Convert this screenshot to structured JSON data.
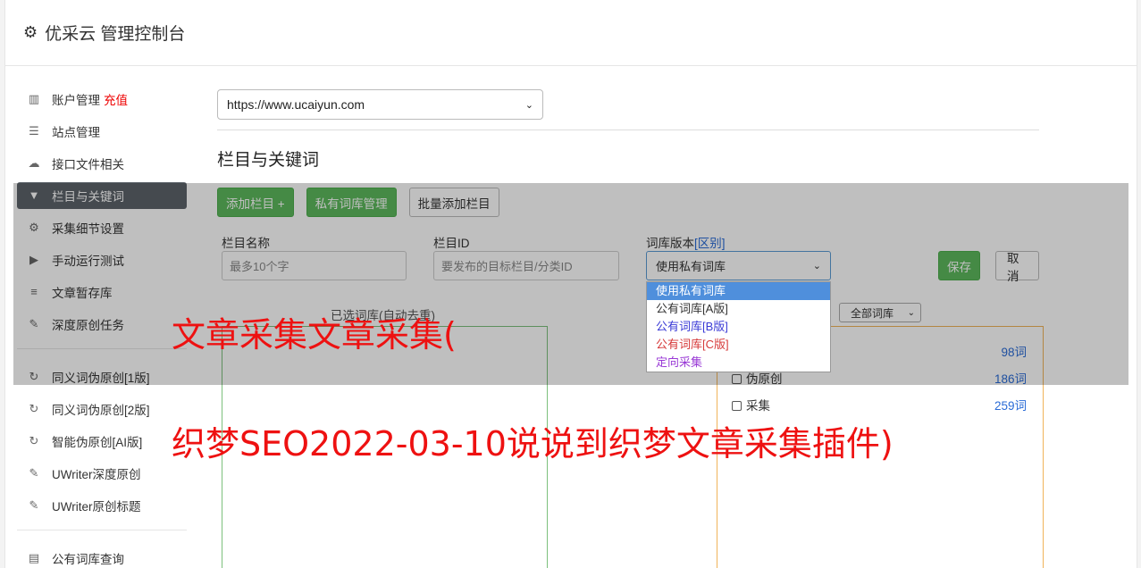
{
  "header": {
    "title": "优采云 管理控制台"
  },
  "sidebar": {
    "items": [
      {
        "label": "账户管理",
        "badge": "充值",
        "icon": "bar-chart-icon"
      },
      {
        "label": "站点管理",
        "icon": "server-icon"
      },
      {
        "label": "接口文件相关",
        "icon": "cloud-upload-icon"
      },
      {
        "label": "栏目与关键词",
        "icon": "filter-icon"
      },
      {
        "label": "采集细节设置",
        "icon": "cogs-icon"
      },
      {
        "label": "手动运行测试",
        "icon": "play-circle-icon"
      },
      {
        "label": "文章暂存库",
        "icon": "database-icon"
      },
      {
        "label": "深度原创任务",
        "icon": "edit-icon"
      }
    ],
    "items2": [
      {
        "label": "同义词伪原创[1版]",
        "icon": "refresh-icon"
      },
      {
        "label": "同义词伪原创[2版]",
        "icon": "refresh-icon"
      },
      {
        "label": "智能伪原创[AI版]",
        "icon": "refresh-icon"
      },
      {
        "label": "UWriter深度原创",
        "icon": "edit-icon"
      },
      {
        "label": "UWriter原创标题",
        "icon": "edit-icon"
      }
    ],
    "items3": [
      {
        "label": "公有词库查询",
        "icon": "book-icon"
      }
    ]
  },
  "main": {
    "site_select": "https://www.ucaiyun.com",
    "section_title": "栏目与关键词",
    "buttons": {
      "add_column": "添加栏目 +",
      "private_lib": "私有词库管理",
      "batch_add": "批量添加栏目"
    },
    "form": {
      "name_label": "栏目名称",
      "name_placeholder": "最多10个字",
      "id_label": "栏目ID",
      "id_placeholder": "要发布的目标栏目/分类ID",
      "lib_label": "词库版本",
      "lib_link": "[区别]",
      "lib_selected": "使用私有词库",
      "save": "保存",
      "cancel": "取消"
    },
    "lib_options": [
      {
        "label": "使用私有词库",
        "color": "#ffffff"
      },
      {
        "label": "公有词库[A版]",
        "color": "#333333"
      },
      {
        "label": "公有词库[B版]",
        "color": "#3a3ad6"
      },
      {
        "label": "公有词库[C版]",
        "color": "#d63a3a"
      },
      {
        "label": "定向采集",
        "color": "#9a3ad6"
      }
    ],
    "selected_label": "已选词库(自动去重)",
    "all_lib_select": "全部词库",
    "lib_list": [
      {
        "label": "",
        "count": "98词"
      },
      {
        "label": "伪原创",
        "count": "186词"
      },
      {
        "label": "采集",
        "count": "259词"
      }
    ]
  },
  "watermark": {
    "line1": "文章采集文章采集(",
    "line2": "织梦SEO2022-03-10说说到织梦文章采集插件)"
  }
}
